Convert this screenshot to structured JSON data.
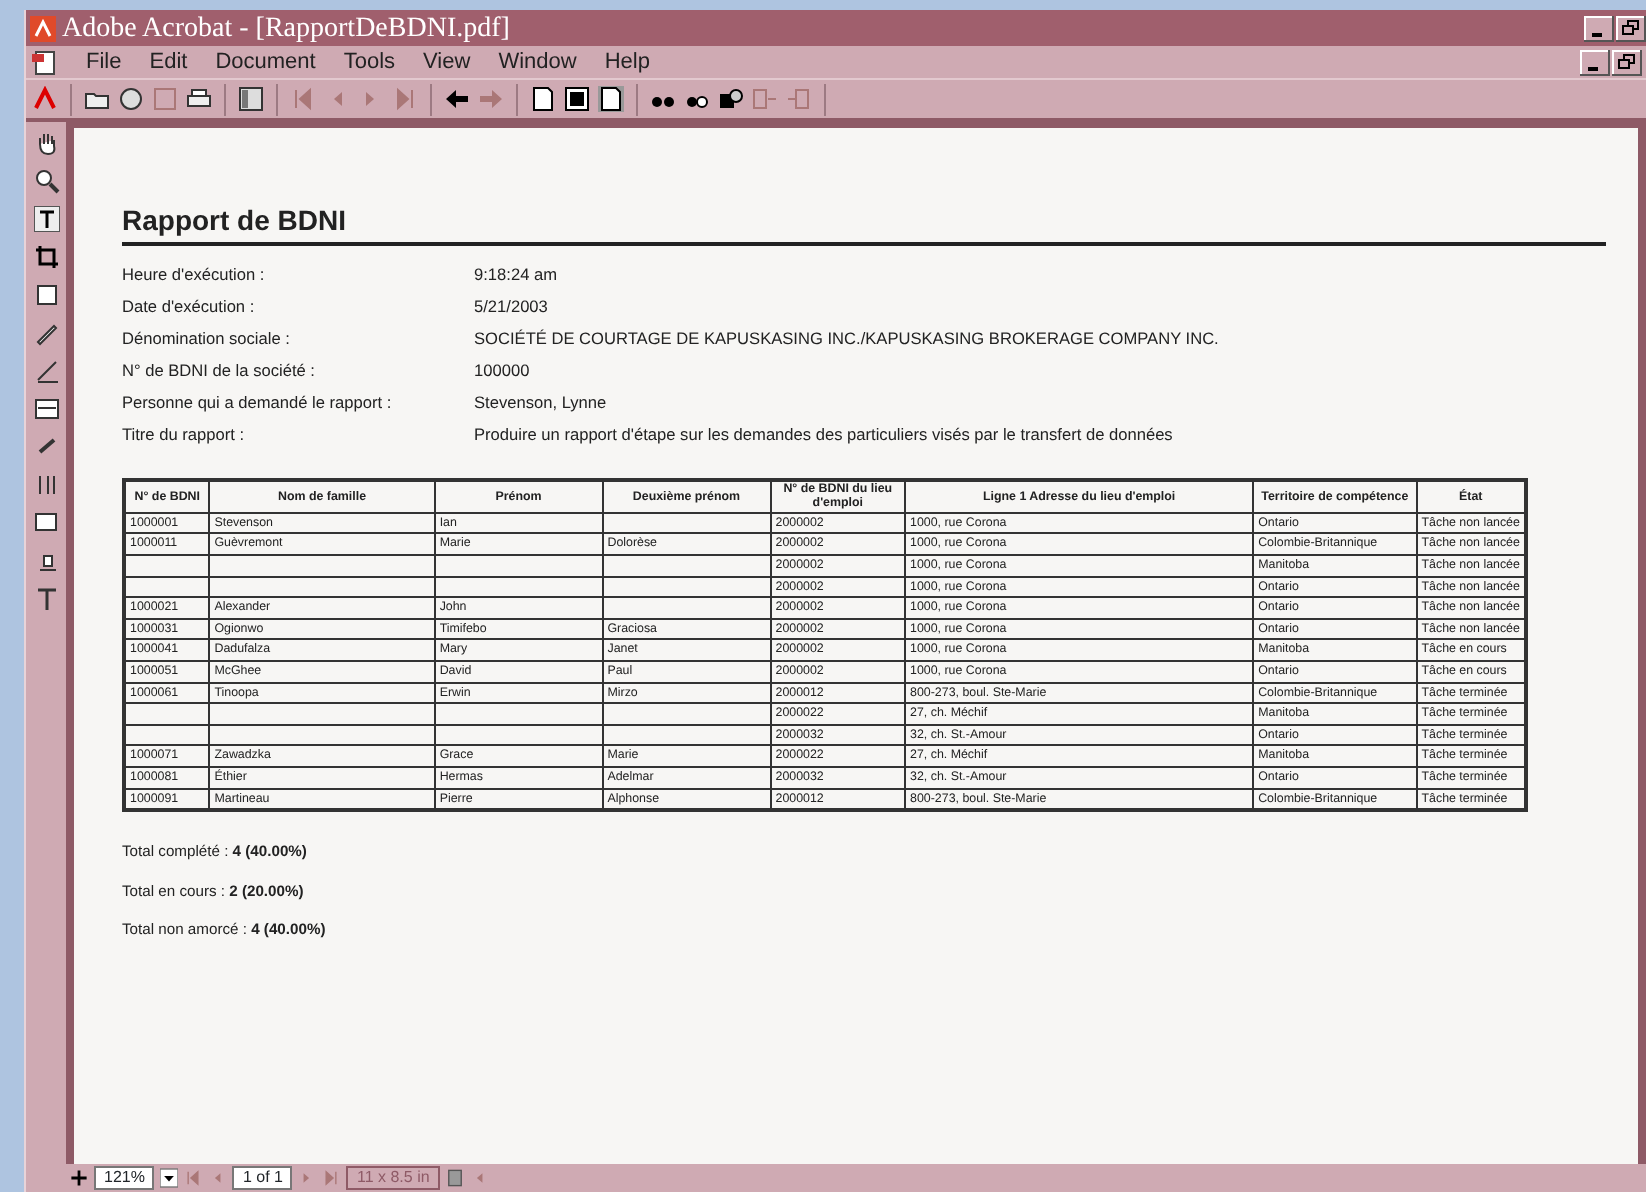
{
  "window": {
    "title": "Adobe Acrobat - [RapportDeBDNI.pdf]"
  },
  "menu": [
    "File",
    "Edit",
    "Document",
    "Tools",
    "View",
    "Window",
    "Help"
  ],
  "report": {
    "title": "Rapport de BDNI",
    "fields": [
      {
        "label": "Heure d'exécution :",
        "value": "9:18:24 am"
      },
      {
        "label": "Date d'exécution :",
        "value": "5/21/2003"
      },
      {
        "label": "Dénomination sociale :",
        "value": "SOCIÉTÉ DE COURTAGE DE KAPUSKASING INC./KAPUSKASING BROKERAGE COMPANY INC."
      },
      {
        "label": "N° de BDNI de la société :",
        "value": "100000"
      },
      {
        "label": "Personne qui a demandé le rapport :",
        "value": "Stevenson, Lynne"
      },
      {
        "label": "Titre du rapport :",
        "value": "Produire un rapport d'étape sur les demandes des particuliers visés par le transfert de données"
      }
    ],
    "table": {
      "columns": [
        "N° de BDNI",
        "Nom de famille",
        "Prénom",
        "Deuxième prénom",
        "N° de BDNI du lieu d'emploi",
        "Ligne 1 Adresse du lieu d'emploi",
        "Territoire de compétence",
        "État"
      ],
      "rows": [
        [
          "1000001",
          "Stevenson",
          "Ian",
          "",
          "2000002",
          "1000, rue Corona",
          "Ontario",
          "Tâche non lancée"
        ],
        [
          "1000011",
          "Guèvremont",
          "Marie",
          "Dolorèse",
          "2000002",
          "1000, rue Corona",
          "Colombie-Britannique",
          "Tâche non lancée"
        ],
        [
          "",
          "",
          "",
          "",
          "2000002",
          "1000, rue Corona",
          "Manitoba",
          "Tâche non lancée"
        ],
        [
          "",
          "",
          "",
          "",
          "2000002",
          "1000, rue Corona",
          "Ontario",
          "Tâche non lancée"
        ],
        [
          "1000021",
          "Alexander",
          "John",
          "",
          "2000002",
          "1000, rue Corona",
          "Ontario",
          "Tâche non lancée"
        ],
        [
          "1000031",
          "Ogionwo",
          "Timifebo",
          "Graciosa",
          "2000002",
          "1000, rue Corona",
          "Ontario",
          "Tâche non lancée"
        ],
        [
          "1000041",
          "Dadufalza",
          "Mary",
          "Janet",
          "2000002",
          "1000, rue Corona",
          "Manitoba",
          "Tâche en cours"
        ],
        [
          "1000051",
          "McGhee",
          "David",
          "Paul",
          "2000002",
          "1000, rue Corona",
          "Ontario",
          "Tâche en cours"
        ],
        [
          "1000061",
          "Tinoopa",
          "Erwin",
          "Mirzo",
          "2000012",
          "800-273, boul. Ste-Marie",
          "Colombie-Britannique",
          "Tâche terminée"
        ],
        [
          "",
          "",
          "",
          "",
          "2000022",
          "27, ch. Méchif",
          "Manitoba",
          "Tâche terminée"
        ],
        [
          "",
          "",
          "",
          "",
          "2000032",
          "32, ch. St.-Amour",
          "Ontario",
          "Tâche terminée"
        ],
        [
          "1000071",
          "Zawadzka",
          "Grace",
          "Marie",
          "2000022",
          "27, ch. Méchif",
          "Manitoba",
          "Tâche terminée"
        ],
        [
          "1000081",
          "Éthier",
          "Hermas",
          "Adelmar",
          "2000032",
          "32, ch. St.-Amour",
          "Ontario",
          "Tâche terminée"
        ],
        [
          "1000091",
          "Martineau",
          "Pierre",
          "Alphonse",
          "2000012",
          "800-273, boul. Ste-Marie",
          "Colombie-Britannique",
          "Tâche terminée"
        ]
      ]
    },
    "totals": [
      "Total complété : **4 (40.00%)**",
      "Total en cours : **2 (20.00%)**",
      "Total non amorcé : **4 (40.00%)**"
    ]
  },
  "status_bar": {
    "zoom": "121%",
    "page": "1 of 1",
    "page_size": "11 x 8.5 in"
  }
}
